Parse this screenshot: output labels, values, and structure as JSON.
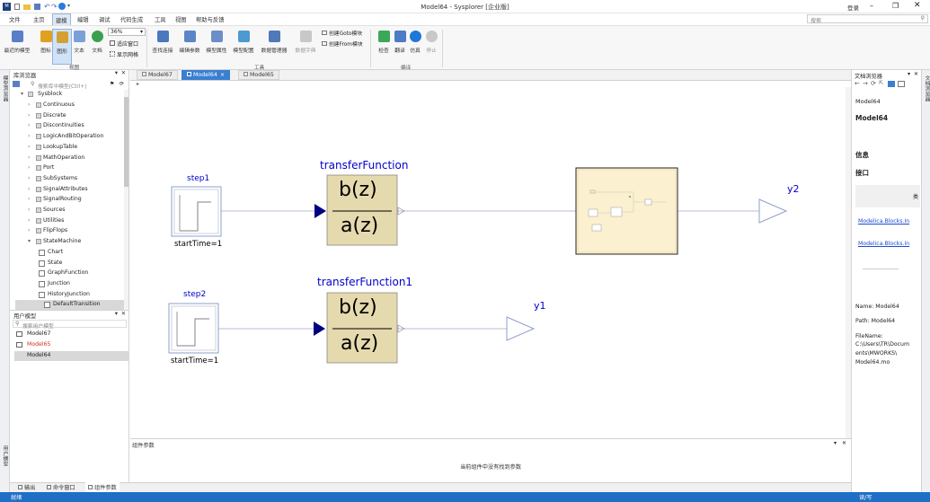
{
  "title": "Model64 - Sysplorer [企业版]",
  "window": {
    "login": "登录"
  },
  "menu": [
    "文件",
    "主页",
    "建模",
    "编辑",
    "调试",
    "代码生成",
    "工具",
    "视图",
    "帮助与反馈"
  ],
  "search_placeholder": "搜索",
  "ribbon": {
    "zoom": "36%",
    "fit_window": "适应窗口",
    "show_grid": "显示网格",
    "buttons": [
      "最近的模型",
      "图标",
      "图形",
      "文本",
      "文档",
      "查找连接",
      "编辑参数",
      "模型属性",
      "模型配置",
      "数据管理器",
      "数据字典",
      "检查",
      "翻译",
      "仿真",
      "停止"
    ],
    "create_goto": "创建Goto模块",
    "create_from": "创建From模块",
    "group_view": "视图",
    "group_tools": "工具",
    "group_compile": "编译"
  },
  "lib_browser": {
    "title": "库浏览器",
    "search_placeholder": "搜索库中模型(Ctrl+)",
    "root": "Sysblock",
    "items": [
      "Continuous",
      "Discrete",
      "Discontinuities",
      "LogicAndBitOperation",
      "LookupTable",
      "MathOperation",
      "Port",
      "SubSystems",
      "SignalAttributes",
      "SignalRouting",
      "Sources",
      "Utilities",
      "FlipFlops",
      "StateMachine"
    ],
    "sub_items": [
      "Chart",
      "State",
      "GraphFunction",
      "Junction",
      "HistoryJunction",
      "DefaultTransition"
    ],
    "left_vtab": "模型浏览器"
  },
  "user_models": {
    "title": "用户模型",
    "search_placeholder": "搜索用户模型",
    "items": [
      "Model67",
      "Model65",
      "Model64"
    ],
    "left_vtab": "用户模型"
  },
  "tabs": [
    "Model67",
    "Model64",
    "Model65"
  ],
  "canvas": {
    "step1": "step1",
    "step2": "step2",
    "start1": "startTime=1",
    "start2": "startTime=1",
    "tf1": "transferFunction",
    "tf2": "transferFunction1",
    "num": "b(z)",
    "den": "a(z)",
    "y1": "y1",
    "y2": "y2"
  },
  "params": {
    "title": "组件参数",
    "empty": "当前组件中没有找到参数"
  },
  "bottom_tabs": [
    "输出",
    "命令窗口",
    "组件参数"
  ],
  "doc_browser": {
    "title": "文档浏览器",
    "model": "Model64",
    "model_bold": "Model64",
    "info": "信息",
    "interface": "接口",
    "col": "类",
    "link1": "Modelica.Blocks.In",
    "link2": "Modelica.Blocks.In",
    "name": "Name: Model64",
    "path": "Path: Model64",
    "filename": "FileName:",
    "file1": "C:\\Users\\TR\\Docum",
    "file2": "ents\\MWORKS\\",
    "file3": "Model64.mo",
    "right_vtab": "文档浏览器"
  },
  "status": {
    "left": "就绪",
    "right": "读/写"
  },
  "colors": {
    "accent": "#1e6fc5",
    "block_fill": "#e8dcb0",
    "label_blue": "#0000cc",
    "status_bar": "#1e6fc5"
  }
}
